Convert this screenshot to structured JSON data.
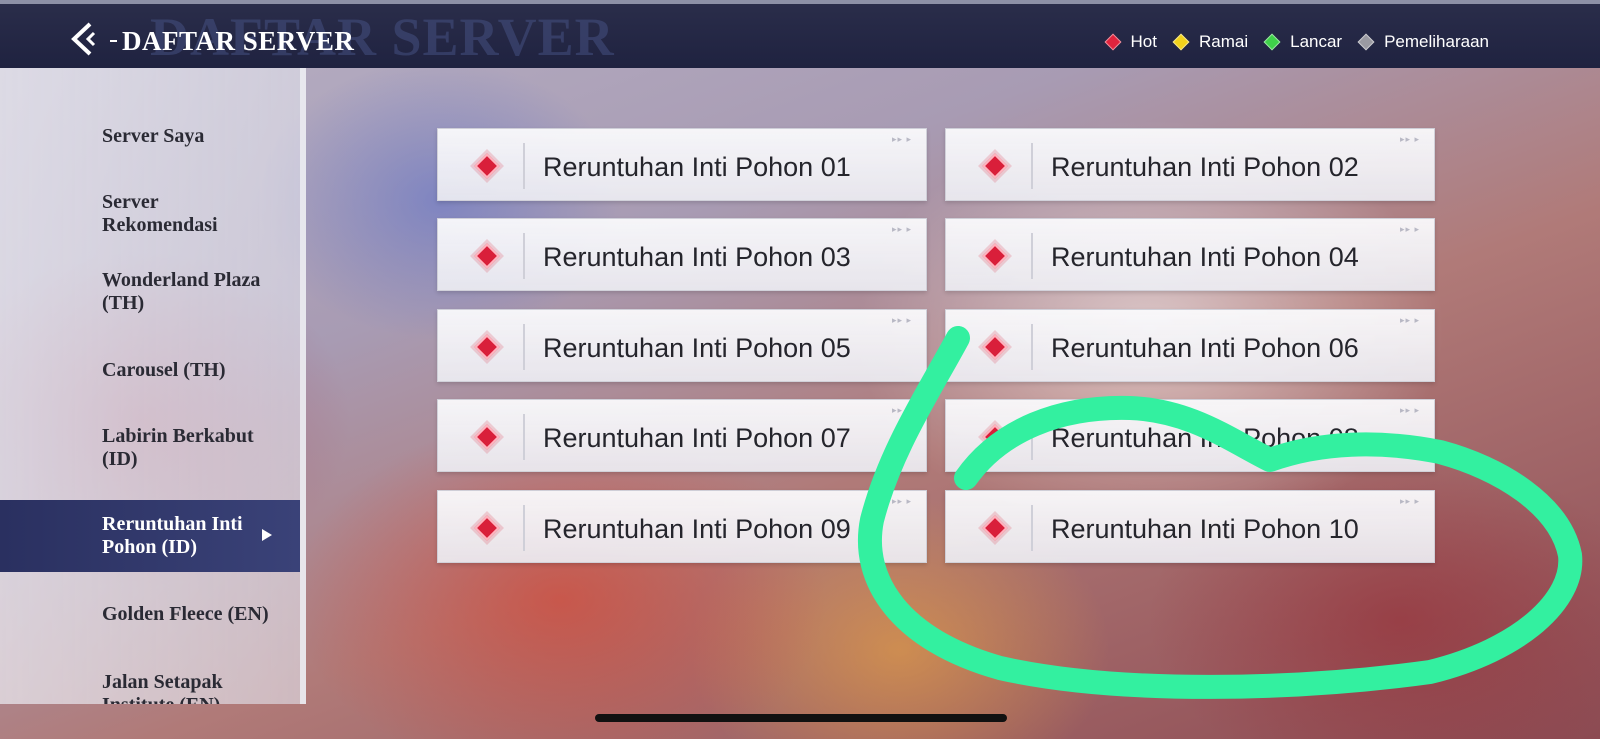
{
  "header": {
    "title": "DAFTAR SERVER",
    "ghost_title": "DAFTAR SERVER",
    "back_icon": "chevron-left-icon",
    "legend": [
      {
        "label": "Hot",
        "color": "#e0243d"
      },
      {
        "label": "Ramai",
        "color": "#f2d21b"
      },
      {
        "label": "Lancar",
        "color": "#3fd14a"
      },
      {
        "label": "Pemeliharaan",
        "color": "#9a9aa2"
      }
    ]
  },
  "sidebar": {
    "items": [
      {
        "label": "Server Saya",
        "active": false
      },
      {
        "label": "Server Rekomendasi",
        "active": false
      },
      {
        "label": "Wonderland Plaza (TH)",
        "active": false
      },
      {
        "label": "Carousel (TH)",
        "active": false
      },
      {
        "label": "Labirin Berkabut (ID)",
        "active": false
      },
      {
        "label": "Reruntuhan Inti Pohon (ID)",
        "active": true
      },
      {
        "label": "Golden Fleece (EN)",
        "active": false
      },
      {
        "label": "Jalan Setapak Institute (EN)",
        "active": false
      }
    ]
  },
  "servers": [
    {
      "name": "Reruntuhan Inti Pohon 01",
      "status": "Hot"
    },
    {
      "name": "Reruntuhan Inti Pohon 02",
      "status": "Hot"
    },
    {
      "name": "Reruntuhan Inti Pohon 03",
      "status": "Hot"
    },
    {
      "name": "Reruntuhan Inti Pohon 04",
      "status": "Hot"
    },
    {
      "name": "Reruntuhan Inti Pohon 05",
      "status": "Hot"
    },
    {
      "name": "Reruntuhan Inti Pohon 06",
      "status": "Hot"
    },
    {
      "name": "Reruntuhan Inti Pohon 07",
      "status": "Hot"
    },
    {
      "name": "Reruntuhan Inti Pohon 08",
      "status": "Hot"
    },
    {
      "name": "Reruntuhan Inti Pohon 09",
      "status": "Hot"
    },
    {
      "name": "Reruntuhan Inti Pohon 10",
      "status": "Hot"
    }
  ],
  "card_corner_mark": "▸▸ ▸",
  "annotation": {
    "color": "#33f0a0"
  }
}
